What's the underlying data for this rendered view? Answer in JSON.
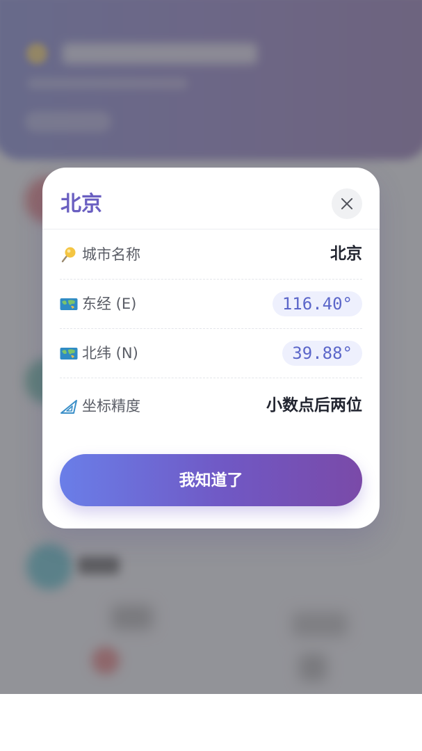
{
  "dialog": {
    "title": "北京",
    "close_icon": "close-icon",
    "rows": [
      {
        "icon": "pin-icon",
        "label": "城市名称",
        "value": "北京"
      },
      {
        "icon": "world-map-icon",
        "label": "东经 (E)",
        "value": "116.40°"
      },
      {
        "icon": "world-map-icon",
        "label": "北纬 (N)",
        "value": "39.88°"
      },
      {
        "icon": "triangle-ruler-icon",
        "label": "坐标精度",
        "value": "小数点后两位"
      }
    ],
    "confirm_label": "我知道了"
  },
  "colors": {
    "accent": "#6a5fc1",
    "pill_bg": "#eef0fd",
    "pill_text": "#5b66c9",
    "button_gradient_start": "#6a7ee8",
    "button_gradient_end": "#7a4aa8"
  }
}
